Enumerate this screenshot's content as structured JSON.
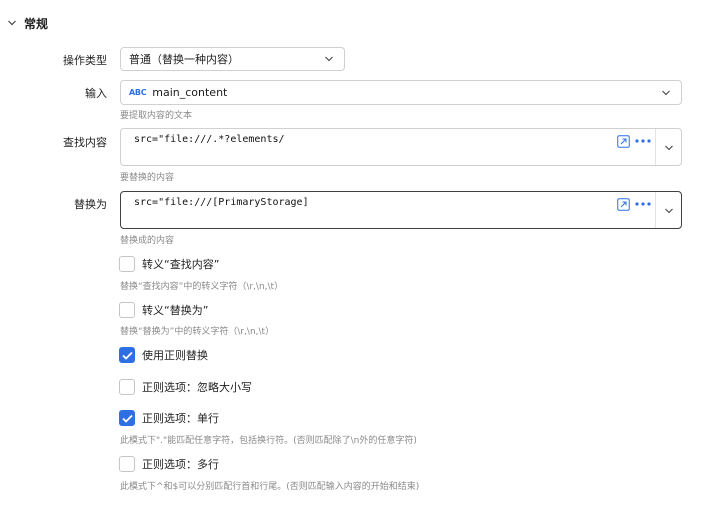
{
  "section": {
    "title": "常规"
  },
  "fields": {
    "operation_type": {
      "label": "操作类型",
      "value": "普通（替换一种内容）"
    },
    "input": {
      "label": "输入",
      "var_type": "ABC",
      "value": "main_content",
      "hint": "要提取内容的文本"
    },
    "find": {
      "label": "查找内容",
      "value": "src=\"file:///.*?elements/",
      "hint": "要替换的内容"
    },
    "replace": {
      "label": "替换为",
      "value": "src=\"file:///[PrimaryStorage]",
      "hint": "替换成的内容"
    }
  },
  "options": [
    {
      "label": "转义“查找内容”",
      "checked": false,
      "hint": "替换“查找内容”中的转义字符（\\r,\\n,\\t）"
    },
    {
      "label": "转义“替换为”",
      "checked": false,
      "hint": "替换“替换为”中的转义字符（\\r,\\n,\\t）"
    },
    {
      "label": "使用正则替换",
      "checked": true,
      "hint": ""
    },
    {
      "label": "正则选项：忽略大小写",
      "checked": false,
      "hint": ""
    },
    {
      "label": "正则选项：单行",
      "checked": true,
      "hint": "此模式下\".\"能匹配任意字符，包括换行符。(否则匹配除了\\n外的任意字符)"
    },
    {
      "label": "正则选项：多行",
      "checked": false,
      "hint": "此模式下^和$可以分别匹配行首和行尾。(否则匹配输入内容的开始和结束)"
    }
  ],
  "colors": {
    "accent": "#2f6fe4",
    "hint": "#8a8a8a",
    "border": "#d0d0d0"
  }
}
